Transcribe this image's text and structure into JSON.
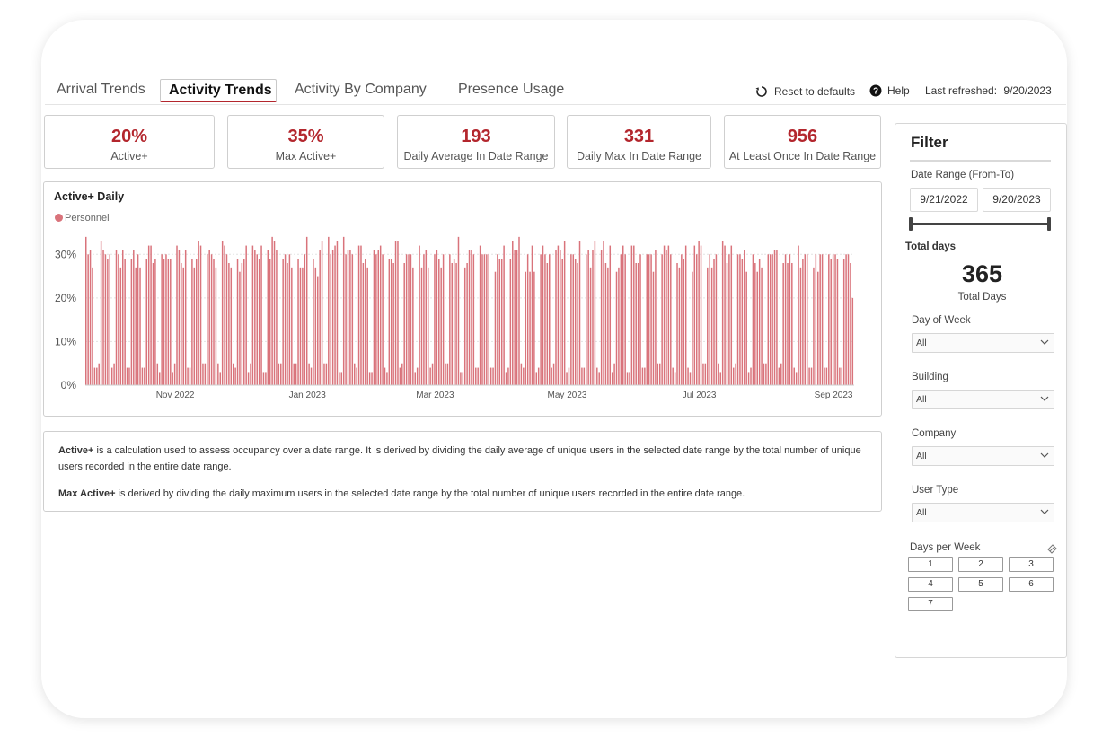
{
  "tabs": [
    {
      "label": "Arrival Trends",
      "active": false
    },
    {
      "label": "Activity Trends",
      "active": true
    },
    {
      "label": "Activity By Company",
      "active": false
    },
    {
      "label": "Presence Usage",
      "active": false
    }
  ],
  "actions": {
    "reset_label": "Reset to defaults",
    "help_label": "Help",
    "last_refreshed_label": "Last refreshed:",
    "last_refreshed_value": "9/20/2023"
  },
  "kpis": [
    {
      "value": "20%",
      "label": "Active+"
    },
    {
      "value": "35%",
      "label": "Max Active+"
    },
    {
      "value": "193",
      "label": "Daily Average In Date Range"
    },
    {
      "value": "331",
      "label": "Daily Max In Date Range"
    },
    {
      "value": "956",
      "label": "At Least Once In Date Range"
    }
  ],
  "colors": {
    "accent": "#b3262d",
    "bar": "#d9737b",
    "legend": "#d9737b"
  },
  "chart_data": {
    "type": "bar",
    "title": "Active+ Daily",
    "legend": [
      {
        "name": "Personnel",
        "color": "#d9737b"
      }
    ],
    "xlabel": "",
    "ylabel": "",
    "yticks": [
      "0%",
      "10%",
      "20%",
      "30%"
    ],
    "ylim": [
      0,
      35
    ],
    "xticks": [
      "Nov 2022",
      "Jan 2023",
      "Mar 2023",
      "May 2023",
      "Jul 2023",
      "Sep 2023"
    ],
    "grid": true,
    "series": [
      {
        "name": "Personnel",
        "values": [
          34,
          30,
          31,
          27,
          4,
          4,
          5,
          33,
          31,
          30,
          29,
          30,
          4,
          5,
          31,
          30,
          27,
          31,
          29,
          4,
          4,
          29,
          31,
          27,
          30,
          27,
          4,
          4,
          29,
          32,
          32,
          28,
          29,
          5,
          3,
          30,
          29,
          30,
          29,
          29,
          3,
          5,
          32,
          31,
          28,
          27,
          31,
          4,
          4,
          29,
          27,
          29,
          33,
          32,
          5,
          5,
          30,
          31,
          30,
          29,
          27,
          5,
          3,
          33,
          32,
          30,
          28,
          27,
          5,
          4,
          29,
          26,
          28,
          29,
          32,
          3,
          5,
          32,
          31,
          30,
          29,
          32,
          3,
          3,
          31,
          29,
          34,
          33,
          31,
          5,
          5,
          29,
          30,
          28,
          30,
          27,
          5,
          5,
          29,
          27,
          27,
          30,
          34,
          5,
          4,
          29,
          27,
          25,
          31,
          33,
          5,
          5,
          34,
          30,
          31,
          32,
          33,
          3,
          3,
          34,
          30,
          31,
          31,
          30,
          5,
          4,
          32,
          32,
          28,
          29,
          27,
          3,
          3,
          31,
          30,
          31,
          32,
          30,
          4,
          3,
          29,
          29,
          28,
          33,
          33,
          4,
          5,
          28,
          30,
          30,
          30,
          27,
          3,
          4,
          32,
          27,
          30,
          31,
          27,
          4,
          5,
          30,
          31,
          29,
          27,
          30,
          5,
          5,
          30,
          28,
          29,
          28,
          34,
          3,
          3,
          27,
          28,
          31,
          31,
          30,
          4,
          4,
          32,
          30,
          30,
          30,
          30,
          4,
          4,
          26,
          30,
          29,
          29,
          32,
          3,
          4,
          29,
          33,
          31,
          31,
          34,
          5,
          4,
          26,
          30,
          26,
          32,
          26,
          3,
          4,
          30,
          32,
          30,
          28,
          30,
          4,
          5,
          31,
          32,
          31,
          29,
          33,
          3,
          4,
          30,
          30,
          29,
          28,
          33,
          4,
          4,
          30,
          31,
          27,
          31,
          33,
          4,
          3,
          31,
          33,
          28,
          27,
          32,
          3,
          5,
          26,
          27,
          30,
          32,
          30,
          3,
          3,
          32,
          32,
          28,
          28,
          30,
          4,
          4,
          30,
          30,
          30,
          26,
          31,
          5,
          5,
          30,
          32,
          31,
          32,
          30,
          4,
          3,
          28,
          27,
          30,
          29,
          32,
          4,
          3,
          26,
          32,
          30,
          33,
          32,
          5,
          5,
          27,
          30,
          27,
          29,
          30,
          5,
          3,
          33,
          32,
          28,
          30,
          32,
          4,
          5,
          30,
          30,
          29,
          31,
          26,
          3,
          4,
          30,
          28,
          26,
          29,
          27,
          5,
          5,
          30,
          30,
          30,
          31,
          31,
          4,
          5,
          28,
          30,
          28,
          30,
          28,
          4,
          3,
          32,
          27,
          29,
          30,
          30,
          4,
          4,
          27,
          30,
          26,
          30,
          30,
          4,
          4,
          30,
          29,
          30,
          30,
          29,
          4,
          4,
          29,
          30,
          30,
          28,
          20
        ]
      }
    ]
  },
  "notes": {
    "p1_term": "Active+",
    "p1_text": " is a calculation used to assess occupancy over a date range. It is derived by dividing the daily average of unique users in the selected date range by the total number of unique users recorded in the entire date range.",
    "p2_term": "Max Active+",
    "p2_text": " is derived by dividing the daily maximum users in the selected date range by the total number of unique users recorded in the entire date range."
  },
  "filter": {
    "title": "Filter",
    "date_range_label": "Date Range (From-To)",
    "date_from": "9/21/2022",
    "date_to": "9/20/2023",
    "total_days_label": "Total days",
    "total_days_value": "365",
    "total_days_caption": "Total Days",
    "day_of_week": {
      "label": "Day of Week",
      "value": "All"
    },
    "building": {
      "label": "Building",
      "value": "All"
    },
    "company": {
      "label": "Company",
      "value": "All"
    },
    "user_type": {
      "label": "User Type",
      "value": "All"
    },
    "days_per_week_label": "Days per Week",
    "days_per_week_options": [
      "1",
      "2",
      "3",
      "4",
      "5",
      "6",
      "7"
    ]
  }
}
